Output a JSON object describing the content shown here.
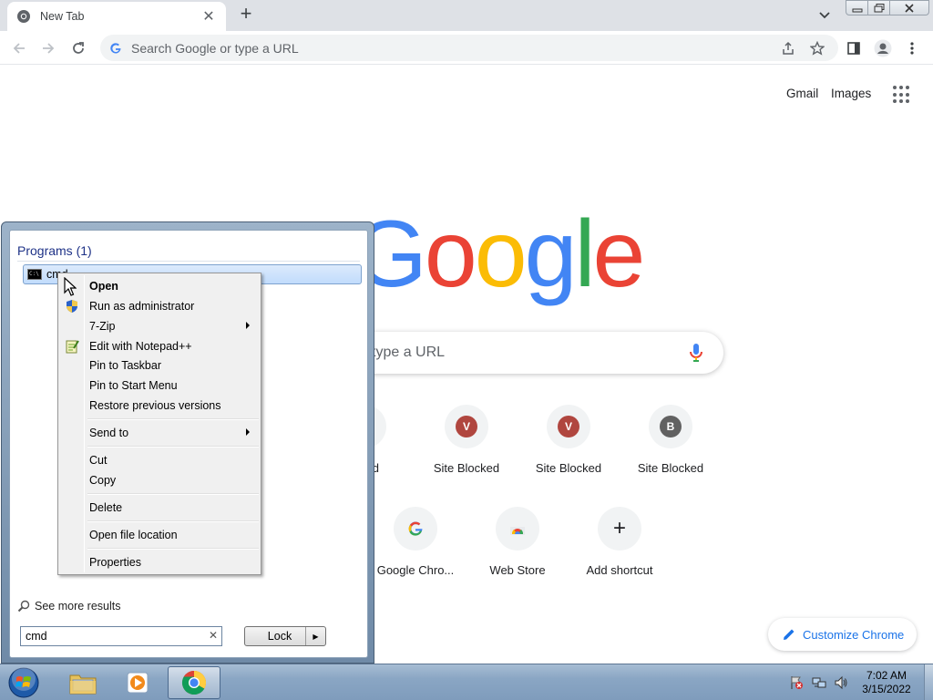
{
  "browser": {
    "tab_title": "New Tab",
    "omnibox_placeholder": "Search Google or type a URL"
  },
  "ntp": {
    "top_links": [
      "Gmail",
      "Images"
    ],
    "search_placeholder_visible": "type a URL",
    "shortcuts": [
      {
        "label": "...cked",
        "letter": "",
        "color": "#b0463f"
      },
      {
        "label": "Site Blocked",
        "letter": "V",
        "color": "#b0463f"
      },
      {
        "label": "Site Blocked",
        "letter": "V",
        "color": "#b0463f"
      },
      {
        "label": "Site Blocked",
        "letter": "B",
        "color": "#616161"
      },
      {
        "label": "Google Chro...",
        "letter": "",
        "color": ""
      },
      {
        "label": "Web Store",
        "letter": "",
        "color": ""
      },
      {
        "label": "Add shortcut",
        "letter": "+",
        "color": ""
      }
    ],
    "customize_label": "Customize Chrome"
  },
  "start_menu": {
    "programs_header": "Programs (1)",
    "program_item": "cmd",
    "see_more": "See more results",
    "search_value": "cmd",
    "lock_label": "Lock"
  },
  "context_menu": {
    "items": [
      {
        "label": "Open",
        "bold": true
      },
      {
        "label": "Run as administrator"
      },
      {
        "label": "7-Zip",
        "submenu": true
      },
      {
        "label": "Edit with Notepad++"
      },
      {
        "label": "Pin to Taskbar"
      },
      {
        "label": "Pin to Start Menu"
      },
      {
        "label": "Restore previous versions"
      },
      {
        "label": "Send to",
        "submenu": true
      },
      {
        "label": "Cut"
      },
      {
        "label": "Copy"
      },
      {
        "label": "Delete"
      },
      {
        "label": "Open file location"
      },
      {
        "label": "Properties"
      }
    ]
  },
  "taskbar": {
    "time": "7:02 AM",
    "date": "3/15/2022"
  }
}
